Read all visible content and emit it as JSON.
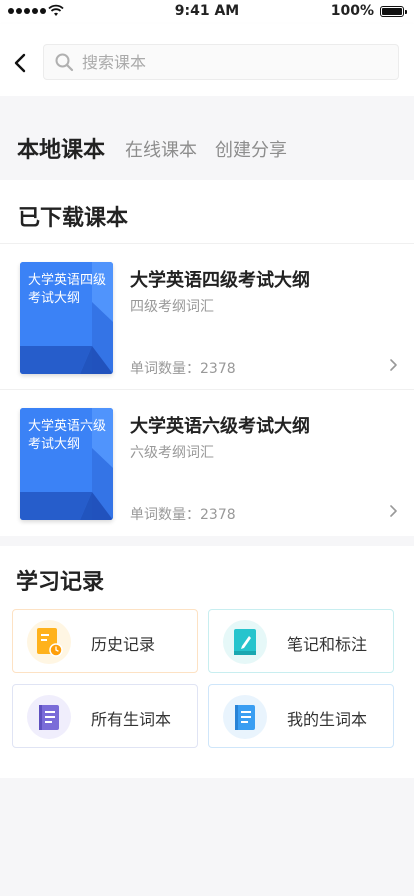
{
  "status_bar": {
    "time": "9:41 AM",
    "battery": "100%"
  },
  "search": {
    "placeholder": "搜索课本"
  },
  "tabs": [
    {
      "label": "本地课本"
    },
    {
      "label": "在线课本"
    },
    {
      "label": "创建分享"
    }
  ],
  "downloaded": {
    "title": "已下载课本",
    "books": [
      {
        "cover_text": "大学英语四级考试大纲",
        "title": "大学英语四级考试大纲",
        "subtitle": "四级考纲词汇",
        "count": "单词数量：2378"
      },
      {
        "cover_text": "大学英语六级考试大纲",
        "title": "大学英语六级考试大纲",
        "subtitle": "六级考纲词汇",
        "count": "单词数量：2378"
      }
    ]
  },
  "records": {
    "title": "学习记录",
    "cards": [
      {
        "label": "历史记录",
        "icon": "history-icon",
        "color": "#ffb21c"
      },
      {
        "label": "笔记和标注",
        "icon": "notes-icon",
        "color": "#26c4cd"
      },
      {
        "label": "所有生词本",
        "icon": "wordbook-icon",
        "color": "#7a6cd8"
      },
      {
        "label": "我的生词本",
        "icon": "my-wordbook-icon",
        "color": "#3a9ef2"
      }
    ]
  },
  "colors": {
    "accent": "#5dd6e8",
    "book_cover": "#2f7df6"
  }
}
